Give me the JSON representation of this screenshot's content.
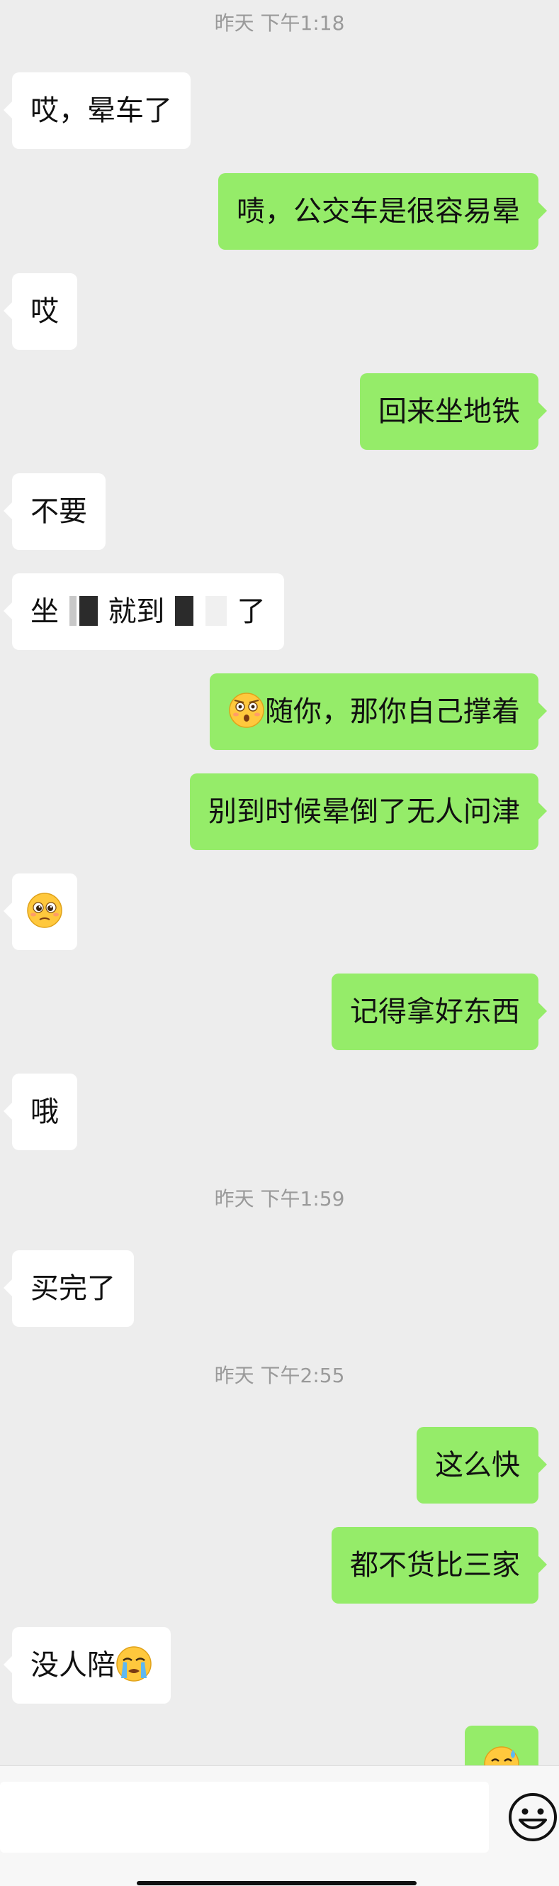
{
  "timestamps": [
    "昨天 下午1:18",
    "昨天 下午1:59",
    "昨天 下午2:55"
  ],
  "messages": [
    {
      "side": "in",
      "text": "哎，晕车了"
    },
    {
      "side": "out",
      "text": "啧，公交车是很容易晕"
    },
    {
      "side": "in",
      "text": "哎"
    },
    {
      "side": "out",
      "text": "回来坐地铁"
    },
    {
      "side": "in",
      "text": "不要"
    },
    {
      "side": "in",
      "text_a": "坐",
      "text_b": "就到",
      "text_c": "了"
    },
    {
      "side": "out",
      "text": "随你，那你自己撑着",
      "emoji": "shocked-face-emoji"
    },
    {
      "side": "out",
      "text": "别到时候晕倒了无人问津"
    },
    {
      "side": "in",
      "emoji": "pleading-face-emoji"
    },
    {
      "side": "out",
      "text": "记得拿好东西"
    },
    {
      "side": "in",
      "text": "哦"
    },
    {
      "side": "in",
      "text": "买完了"
    },
    {
      "side": "out",
      "text": "这么快"
    },
    {
      "side": "out",
      "text": "都不货比三家"
    },
    {
      "side": "in",
      "text": "没人陪",
      "emoji": "crying-face-emoji"
    },
    {
      "side": "out",
      "emoji": "sweat-smile-emoji"
    }
  ],
  "input": {
    "value": "",
    "emoji_button": "smiley-face-icon"
  },
  "colors": {
    "background": "#ededed",
    "incoming": "#ffffff",
    "outgoing": "#95ec69",
    "timestamp": "#9a9a9a"
  }
}
